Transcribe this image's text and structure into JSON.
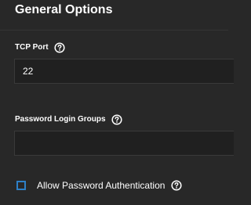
{
  "section": {
    "title": "General Options"
  },
  "tcp_port": {
    "label": "TCP Port",
    "value": "22",
    "help_icon": "help-circle-icon"
  },
  "password_login_groups": {
    "label": "Password Login Groups",
    "value": "",
    "help_icon": "help-circle-icon"
  },
  "allow_password_auth": {
    "label": "Allow Password Authentication",
    "checked": false,
    "help_icon": "help-circle-icon"
  },
  "colors": {
    "background": "#282828",
    "input_background": "#202020",
    "checkbox_accent": "#2e80c7",
    "text": "#ffffff"
  }
}
